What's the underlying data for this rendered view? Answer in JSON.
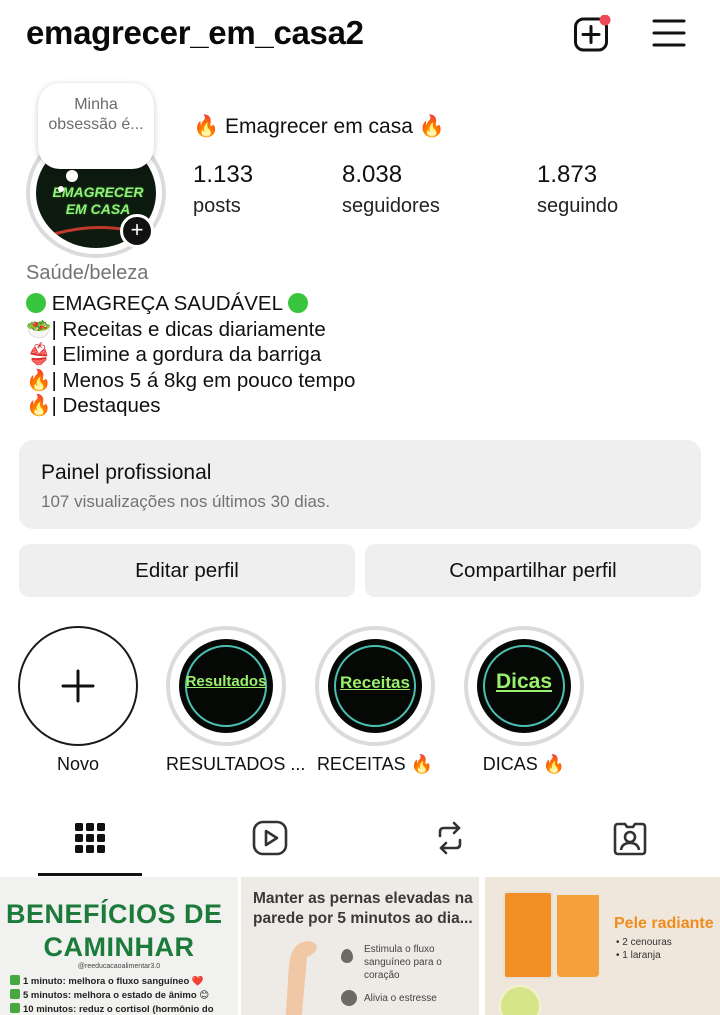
{
  "header": {
    "username": "emagrecer_em_casa2",
    "add_icon": "plus-square-icon",
    "notification_dot_color": "#ed4956",
    "menu_icon": "hamburger-menu-icon"
  },
  "profile": {
    "note": "Minha obsessão é...",
    "avatar_text": "EMAGRECER EM CASA",
    "display_name": "🔥 Emagrecer em casa 🔥",
    "stats": [
      {
        "value": "1.133",
        "label": "posts"
      },
      {
        "value": "8.038",
        "label": "seguidores"
      },
      {
        "value": "1.873",
        "label": "seguindo"
      }
    ],
    "category": "Saúde/beleza",
    "bio": [
      "EMAGREÇA SAUDÁVEL",
      "🥗| Receitas e dicas diariamente",
      "👙| Elimine a gordura da barriga",
      "🔥| Menos 5 á 8kg em pouco tempo",
      "🔥| Destaques"
    ]
  },
  "panel": {
    "title": "Painel profissional",
    "subtitle": "107 visualizações nos últimos 30 dias."
  },
  "buttons": {
    "edit": "Editar perfil",
    "share": "Compartilhar perfil"
  },
  "highlights": {
    "new_label": "Novo",
    "items": [
      {
        "cover": "Resultados",
        "label": "RESULTADOS ..."
      },
      {
        "cover": "Receitas",
        "label": "RECEITAS 🔥"
      },
      {
        "cover": "Dicas",
        "label": "DICAS 🔥"
      }
    ]
  },
  "tabs": [
    "grid-icon",
    "reels-icon",
    "reposts-icon",
    "tagged-icon"
  ],
  "posts": {
    "post1": {
      "title1": "BENEFÍCIOS DE",
      "title2": "CAMINHAR",
      "handle": "@reeducacaoalimentar3.0",
      "lines": [
        "1 minuto: melhora o fluxo sanguíneo ❤️",
        "5 minutos: melhora o estado de ânimo 😊",
        "10 minutos: reduz o cortisol (hormônio do"
      ]
    },
    "post2": {
      "title": "Manter as pernas elevadas na parede por 5 minutos ao dia...",
      "item1": "Estimula o fluxo sanguíneo para o coração",
      "item2": "Alivia o estresse"
    },
    "post3": {
      "title": "Pele radiante",
      "items": [
        "• 2 cenouras",
        "• 1 laranja"
      ]
    }
  }
}
